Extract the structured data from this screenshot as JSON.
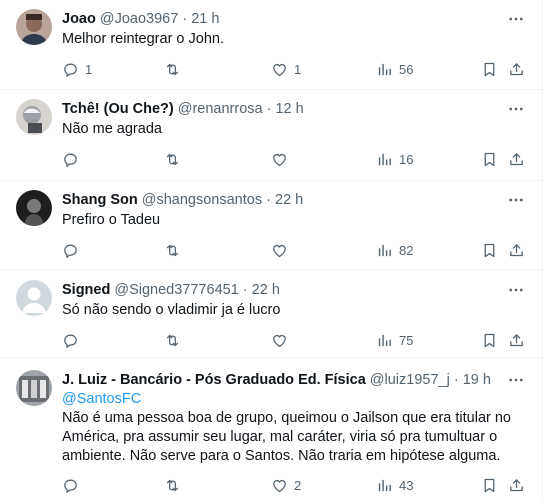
{
  "tweets": [
    {
      "name": "Joao",
      "handle": "@Joao3967",
      "time": "21 h",
      "text": "Melhor reintegrar o John.",
      "mention": "",
      "replies": "1",
      "retweets": "",
      "likes": "1",
      "views": "56",
      "avatar_color": "#8a6a5a"
    },
    {
      "name": "Tchê! (Ou Che?)",
      "handle": "@renanrrosa",
      "time": "12 h",
      "text": "Não me agrada",
      "mention": "",
      "replies": "",
      "retweets": "",
      "likes": "",
      "views": "16",
      "avatar_color": "#9aa0a6"
    },
    {
      "name": "Shang Son",
      "handle": "@shangsonsantos",
      "time": "22 h",
      "text": "Prefiro o Tadeu",
      "mention": "",
      "replies": "",
      "retweets": "",
      "likes": "",
      "views": "82",
      "avatar_color": "#2b2b2b"
    },
    {
      "name": "Signed",
      "handle": "@Signed37776451",
      "time": "22 h",
      "text": "Só não sendo o vladimir ja é lucro",
      "mention": "",
      "replies": "",
      "retweets": "",
      "likes": "",
      "views": "75",
      "avatar_color": "#cfd9de"
    },
    {
      "name": "J. Luiz - Bancário - Pós Graduado Ed. Física",
      "handle": "@luiz1957_j",
      "time": "19 h",
      "text": "Não é uma pessoa boa de grupo, queimou o Jailson que era titular no América, pra assumir seu lugar, mal caráter, viria só pra tumultuar o ambiente. Não serve para o Santos. Não traria em hipótese alguma.",
      "mention": "@SantosFC",
      "replies": "",
      "retweets": "",
      "likes": "2",
      "views": "43",
      "avatar_color": "#6b6f73"
    }
  ],
  "separator": "·",
  "colors": {
    "text": "#0f1419",
    "muted": "#536471",
    "link": "#1d9bf0",
    "border": "#eff3f4"
  },
  "icons": [
    "reply-icon",
    "retweet-icon",
    "like-icon",
    "views-icon",
    "bookmark-icon",
    "share-icon",
    "more-icon"
  ]
}
